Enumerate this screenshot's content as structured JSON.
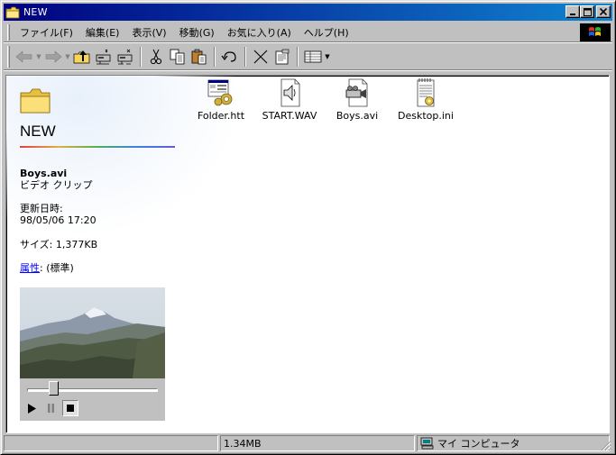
{
  "window": {
    "title": "NEW"
  },
  "menu": [
    {
      "label": "ファイル(F)"
    },
    {
      "label": "編集(E)"
    },
    {
      "label": "表示(V)"
    },
    {
      "label": "移動(G)"
    },
    {
      "label": "お気に入り(A)"
    },
    {
      "label": "ヘルプ(H)"
    }
  ],
  "toolbar": {
    "icons": [
      "back-icon",
      "forward-icon",
      "up-folder-icon",
      "map-drive-icon",
      "disconnect-drive-icon",
      "cut-icon",
      "copy-icon",
      "paste-icon",
      "undo-icon",
      "delete-icon",
      "properties-icon",
      "views-icon"
    ]
  },
  "left_pane": {
    "folder_name": "NEW",
    "selected_name": "Boys.avi",
    "selected_type": "ビデオ クリップ",
    "modified_label": "更新日時:",
    "modified_value": "98/05/06 17:20",
    "size_text": "サイズ: 1,377KB",
    "attributes_link": "属性",
    "attributes_value": ": (標準)"
  },
  "files": [
    {
      "name": "Folder.htt",
      "icon": "html-template-icon"
    },
    {
      "name": "START.WAV",
      "icon": "sound-file-icon"
    },
    {
      "name": "Boys.avi",
      "icon": "video-file-icon"
    },
    {
      "name": "Desktop.ini",
      "icon": "settings-file-icon"
    }
  ],
  "media": {
    "position": 0.18
  },
  "status": {
    "panel1": "",
    "panel2": "1.34MB",
    "panel3": "マイ コンピュータ"
  },
  "colors": {
    "title_start": "#000080",
    "title_end": "#1084d0",
    "face": "#c0c0c0",
    "link": "#0000ff"
  }
}
